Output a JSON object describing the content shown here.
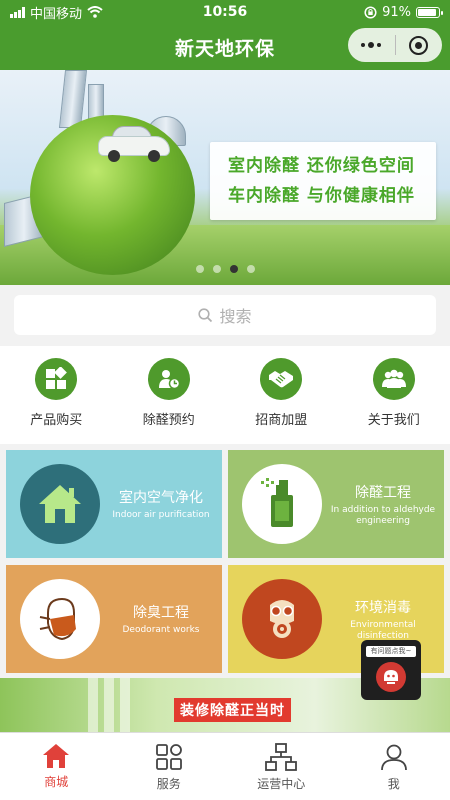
{
  "status_bar": {
    "carrier": "中国移动",
    "time": "10:56",
    "battery": "91%",
    "battery_level": 0.91
  },
  "nav": {
    "title": "新天地环保"
  },
  "banner": {
    "line1": "室内除醛  还你绿色空间",
    "line2": "车内除醛  与你健康相伴",
    "slide_count": 4,
    "active_slide": 3
  },
  "search": {
    "placeholder": "搜索"
  },
  "menu": {
    "items": [
      {
        "label": "产品购买",
        "icon": "grid-icon"
      },
      {
        "label": "除醛预约",
        "icon": "person-clock-icon"
      },
      {
        "label": "招商加盟",
        "icon": "handshake-icon"
      },
      {
        "label": "关于我们",
        "icon": "group-icon"
      }
    ]
  },
  "services": [
    {
      "title": "室内空气净化",
      "subtitle": "Indoor air purification",
      "color": "#8dd3dc",
      "icon": "house-icon"
    },
    {
      "title": "除醛工程",
      "subtitle": "In addition to aldehyde engineering",
      "color": "#9ec46f",
      "icon": "spray-bottle-icon"
    },
    {
      "title": "除臭工程",
      "subtitle": "Deodorant works",
      "color": "#e2a35b",
      "icon": "face-mask-icon"
    },
    {
      "title": "环境消毒",
      "subtitle": "Environmental disinfection",
      "color": "#e6d45c",
      "icon": "gas-mask-icon"
    }
  ],
  "promo": {
    "text": "装修除醛正当时"
  },
  "float_help": {
    "label": "有问题点我~"
  },
  "tabbar": {
    "items": [
      {
        "label": "商城",
        "icon": "home-icon",
        "active": true
      },
      {
        "label": "服务",
        "icon": "services-grid-icon",
        "active": false
      },
      {
        "label": "运营中心",
        "icon": "org-chart-icon",
        "active": false
      },
      {
        "label": "我",
        "icon": "user-icon",
        "active": false
      }
    ]
  },
  "colors": {
    "brand_green": "#4a9c2e",
    "active_red": "#e0413a"
  }
}
